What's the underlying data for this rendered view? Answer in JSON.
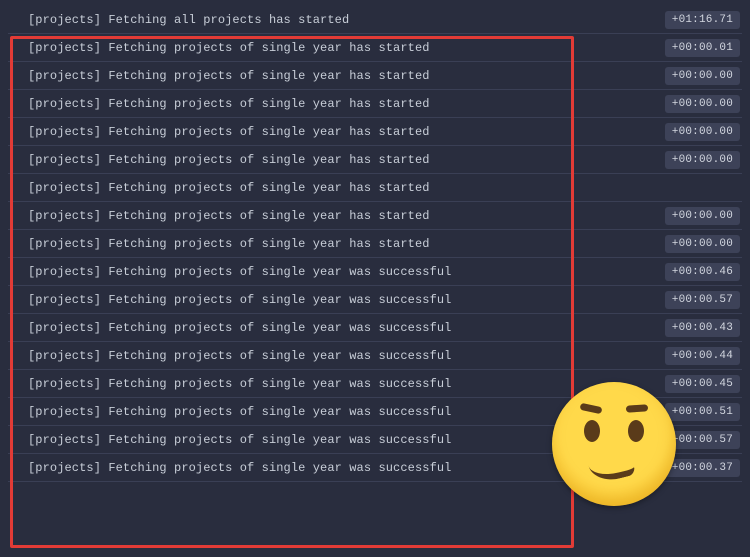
{
  "colors": {
    "background": "#292d3e",
    "row_border": "#3a3f55",
    "text": "#c8ced8",
    "pill_bg": "#3d4258",
    "highlight_border": "#e23b36",
    "emoji_base": "#ffd94a"
  },
  "emoji_name": "confused-face",
  "logs": [
    {
      "text": "[projects] Fetching all projects has started",
      "time": "+01:16.71",
      "highlighted": false
    },
    {
      "text": "[projects] Fetching projects of single year has started",
      "time": "+00:00.01",
      "highlighted": true
    },
    {
      "text": "[projects] Fetching projects of single year has started",
      "time": "+00:00.00",
      "highlighted": true
    },
    {
      "text": "[projects] Fetching projects of single year has started",
      "time": "+00:00.00",
      "highlighted": true
    },
    {
      "text": "[projects] Fetching projects of single year has started",
      "time": "+00:00.00",
      "highlighted": true
    },
    {
      "text": "[projects] Fetching projects of single year has started",
      "time": "+00:00.00",
      "highlighted": true
    },
    {
      "text": "[projects] Fetching projects of single year has started",
      "time": "",
      "highlighted": true
    },
    {
      "text": "[projects] Fetching projects of single year has started",
      "time": "+00:00.00",
      "highlighted": true
    },
    {
      "text": "[projects] Fetching projects of single year has started",
      "time": "+00:00.00",
      "highlighted": true
    },
    {
      "text": "[projects] Fetching projects of single year was successful",
      "time": "+00:00.46",
      "highlighted": true
    },
    {
      "text": "[projects] Fetching projects of single year was successful",
      "time": "+00:00.57",
      "highlighted": true
    },
    {
      "text": "[projects] Fetching projects of single year was successful",
      "time": "+00:00.43",
      "highlighted": true
    },
    {
      "text": "[projects] Fetching projects of single year was successful",
      "time": "+00:00.44",
      "highlighted": true
    },
    {
      "text": "[projects] Fetching projects of single year was successful",
      "time": "+00:00.45",
      "highlighted": true
    },
    {
      "text": "[projects] Fetching projects of single year was successful",
      "time": "+00:00.51",
      "highlighted": true
    },
    {
      "text": "[projects] Fetching projects of single year was successful",
      "time": "+00:00.57",
      "highlighted": true
    },
    {
      "text": "[projects] Fetching projects of single year was successful",
      "time": "+00:00.37",
      "highlighted": true
    }
  ]
}
